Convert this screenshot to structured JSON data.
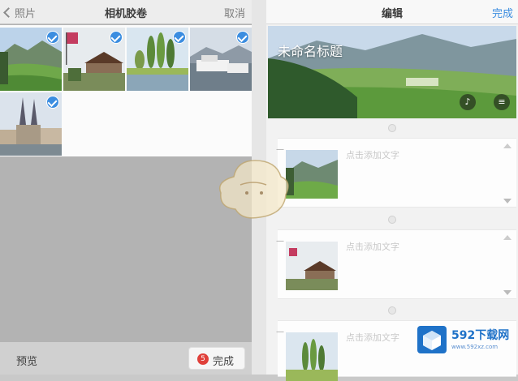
{
  "left_panel": {
    "nav": {
      "back_label": "照片",
      "title": "相机胶卷",
      "cancel_label": "取消"
    },
    "photos": [
      {
        "scene": "valley-mountains",
        "selected": true
      },
      {
        "scene": "flag-chalet",
        "selected": true
      },
      {
        "scene": "poplar-pond",
        "selected": true
      },
      {
        "scene": "harbor-boats",
        "selected": true
      },
      {
        "scene": "church-spires",
        "selected": true
      }
    ],
    "bottom": {
      "preview_label": "预览",
      "done_count": "5",
      "done_label": "完成"
    }
  },
  "right_panel": {
    "nav": {
      "title": "编辑",
      "done_label": "完成"
    },
    "cover": {
      "title": "未命名标题",
      "music_icon": "music-note-icon",
      "menu_icon": "menu-icon"
    },
    "cards": [
      {
        "placeholder": "点击添加文字"
      },
      {
        "placeholder": "点击添加文字"
      },
      {
        "placeholder": "点击添加文字"
      }
    ]
  },
  "watermark": {
    "brand": "592下载网",
    "url": "www.592xz.com"
  },
  "colors": {
    "accent": "#3b8de0",
    "badge": "#e0403a",
    "watermark": "#1f72c8"
  }
}
